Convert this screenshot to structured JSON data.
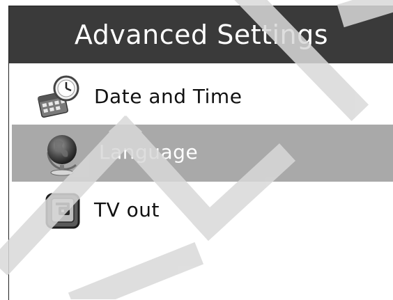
{
  "header": {
    "title": "Advanced Settings"
  },
  "menu": {
    "items": [
      {
        "label": "Date and Time",
        "icon": "calendar-clock-icon",
        "selected": false
      },
      {
        "label": "Language",
        "icon": "globe-icon",
        "selected": true
      },
      {
        "label": "TV out",
        "icon": "tv-out-icon",
        "selected": false
      }
    ]
  },
  "colors": {
    "header_bg": "#3a3a3a",
    "header_text": "#ffffff",
    "selected_bg": "#a9a9a9",
    "selected_text": "#ffffff",
    "item_text": "#111111",
    "watermark": "#d9d9d9"
  }
}
